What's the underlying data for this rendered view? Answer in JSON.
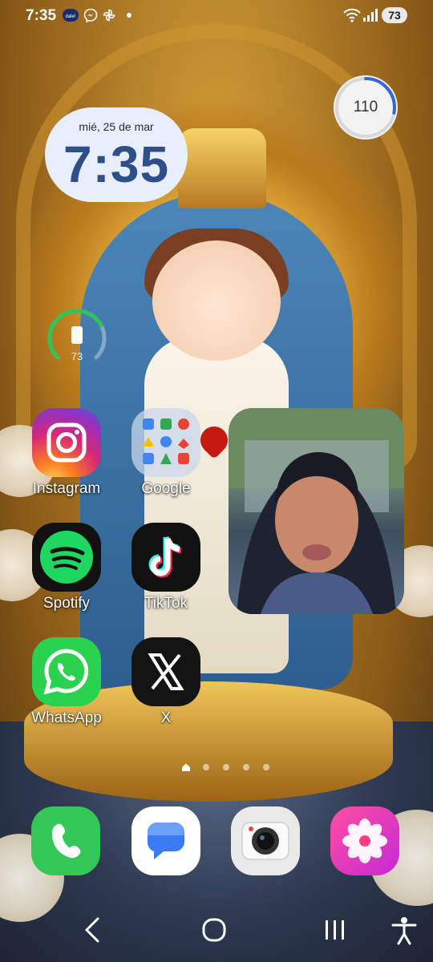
{
  "status_bar": {
    "time": "7:35",
    "notification_icons": [
      "dale-app-icon",
      "messenger-icon",
      "pinwheel-icon",
      "dot-icon"
    ],
    "battery": "73"
  },
  "clock_widget": {
    "date": "mié, 25 de mar",
    "time": "7:35"
  },
  "steps_widget": {
    "value": "110",
    "progress": 0.28
  },
  "battery_widget": {
    "value": "73",
    "progress": 0.73
  },
  "apps": {
    "instagram": "Instagram",
    "google": "Google",
    "spotify": "Spotify",
    "tiktok": "TikTok",
    "whatsapp": "WhatsApp",
    "x": "X"
  },
  "dock": [
    "phone-app",
    "messages-app",
    "camera-app",
    "gallery-app"
  ],
  "page_indicator": {
    "pages": 5,
    "current": 1
  },
  "colors": {
    "clock_text": "#2f4f88",
    "battery_ring": "#2fc35a",
    "steps_ring": "#3868d8"
  }
}
